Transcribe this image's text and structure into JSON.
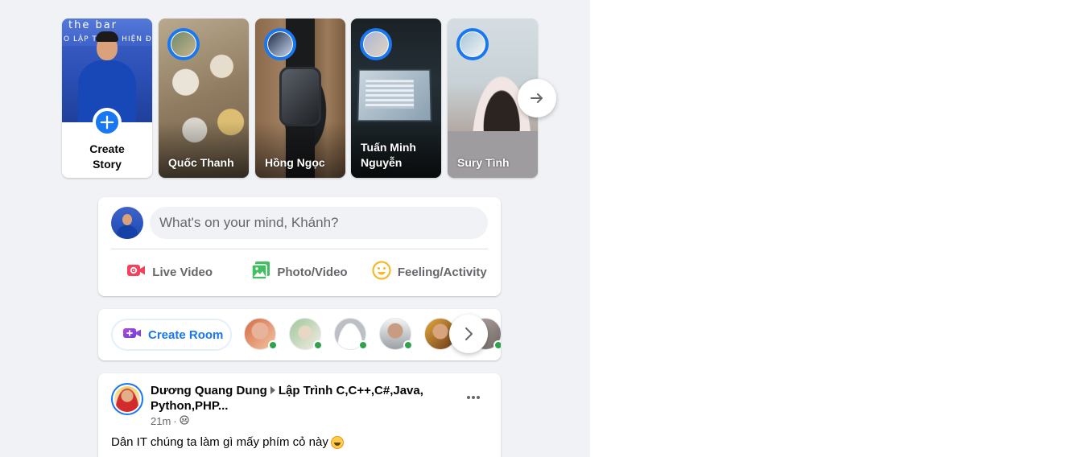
{
  "stories": {
    "create": {
      "photo_banner_line1": "the bar",
      "photo_banner_line2": "O LẬP TRÌNH HIỆN ĐẠI",
      "label_line1": "Create",
      "label_line2": "Story"
    },
    "items": [
      {
        "name": "Quốc Thanh"
      },
      {
        "name": "Hồng Ngọc"
      },
      {
        "name": "Tuấn Minh Nguyễn"
      },
      {
        "name": "Sury Tình"
      }
    ],
    "next_icon": "arrow-right-icon"
  },
  "composer": {
    "placeholder": "What's on your mind, Khánh?",
    "actions": [
      {
        "label": "Live Video",
        "icon": "live-video-icon",
        "color": "#f3425f"
      },
      {
        "label": "Photo/Video",
        "icon": "photo-icon",
        "color": "#45bd62"
      },
      {
        "label": "Feeling/Activity",
        "icon": "feeling-icon",
        "color": "#f7b928"
      }
    ]
  },
  "rooms": {
    "create_label": "Create Room",
    "create_icon": "video-plus-icon",
    "online_color": "#31a24c",
    "next_icon": "chevron-right-icon"
  },
  "post": {
    "author": "Dương Quang Dung",
    "group": "Lập Trình C,C++,C#,Java, Python,PHP...",
    "time": "21m",
    "audience_icon": "group-audience-icon",
    "text": "Dân IT chúng ta làm gì mấy phím cỏ này",
    "emoji": "rofl-emoji-icon",
    "more_icon": "more-horizontal-icon"
  },
  "colors": {
    "accent": "#1877f2",
    "background": "#f0f2f5",
    "secondary_text": "#65676b"
  }
}
